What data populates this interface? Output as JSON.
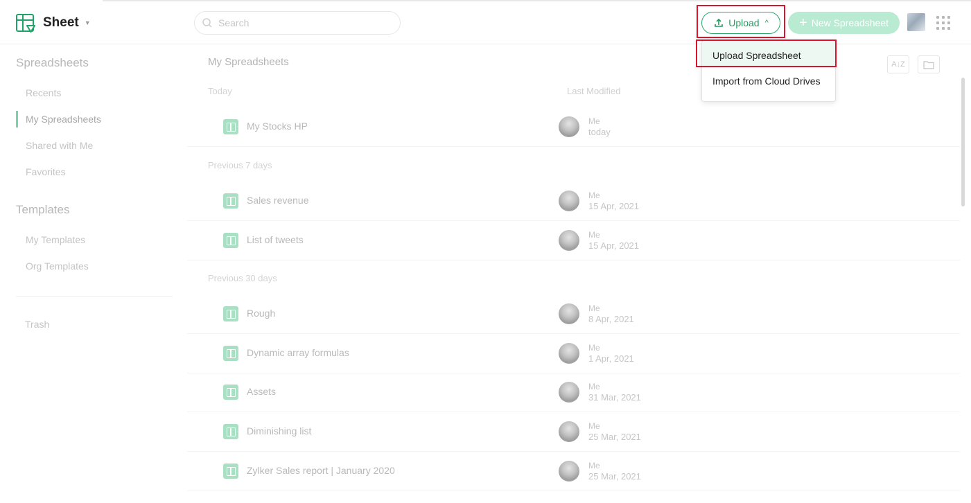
{
  "app": {
    "name": "Sheet"
  },
  "search": {
    "placeholder": "Search"
  },
  "header": {
    "upload_label": "Upload",
    "new_label": "New Spreadsheet"
  },
  "upload_menu": {
    "items": [
      "Upload Spreadsheet",
      "Import from Cloud Drives"
    ]
  },
  "sidebar": {
    "spreadsheets_title": "Spreadsheets",
    "items": [
      "Recents",
      "My Spreadsheets",
      "Shared with Me",
      "Favorites"
    ],
    "templates_title": "Templates",
    "template_items": [
      "My Templates",
      "Org Templates"
    ],
    "trash": "Trash",
    "active": "My Spreadsheets"
  },
  "main": {
    "title": "My Spreadsheets",
    "last_modified_header": "Last Modified",
    "groups": [
      "Today",
      "Previous 7 days",
      "Previous 30 days"
    ],
    "rows": [
      {
        "name": "My Stocks HP",
        "owner": "Me",
        "date": "today"
      },
      {
        "name": "Sales revenue",
        "owner": "Me",
        "date": "15 Apr, 2021"
      },
      {
        "name": "List of tweets",
        "owner": "Me",
        "date": "15 Apr, 2021"
      },
      {
        "name": "Rough",
        "owner": "Me",
        "date": "8 Apr, 2021"
      },
      {
        "name": "Dynamic array formulas",
        "owner": "Me",
        "date": "1 Apr, 2021"
      },
      {
        "name": "Assets",
        "owner": "Me",
        "date": "31 Mar, 2021"
      },
      {
        "name": "Diminishing list",
        "owner": "Me",
        "date": "25 Mar, 2021"
      },
      {
        "name": "Zylker Sales report | January 2020",
        "owner": "Me",
        "date": "25 Mar, 2021"
      }
    ],
    "sort_icon": "sort-az-icon",
    "folder_icon": "folder-icon"
  },
  "colors": {
    "accent": "#1f9b60",
    "highlight": "#d9142b",
    "new_button": "#b9ead2"
  }
}
